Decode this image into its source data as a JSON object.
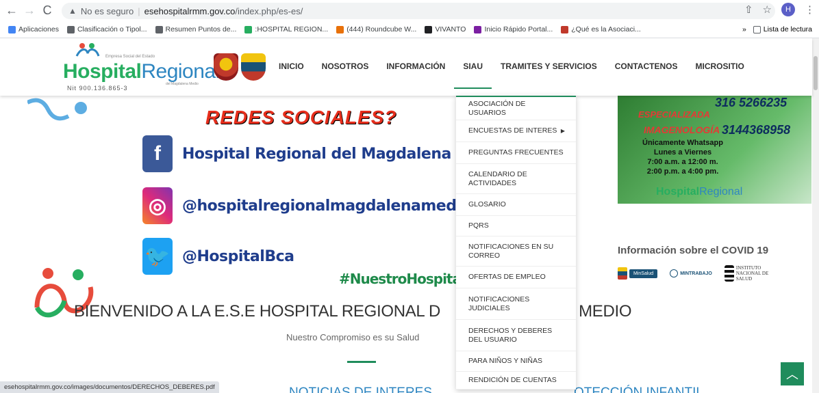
{
  "browser": {
    "security_label": "No es seguro",
    "url_host": "esehospitalrmm.gov.co",
    "url_path": "/index.php/es-es/",
    "profile_initial": "H",
    "bookmarks": [
      {
        "label": "Aplicaciones",
        "icon": "apps-icon",
        "color": "#4285f4"
      },
      {
        "label": "Clasificación o Tipol...",
        "icon": "house-icon",
        "color": "#5f6368"
      },
      {
        "label": "Resumen Puntos de...",
        "icon": "document-icon",
        "color": "#5f6368"
      },
      {
        "label": ":HOSPITAL REGION...",
        "icon": "hospital-logo-icon",
        "color": "#27ae60"
      },
      {
        "label": "(444) Roundcube W...",
        "icon": "roundcube-icon",
        "color": "#e8710a"
      },
      {
        "label": "VIVANTO",
        "icon": "vivanto-icon",
        "color": "#202124"
      },
      {
        "label": "Inicio Rápido Portal...",
        "icon": "portal-icon",
        "color": "#7b1fa2"
      },
      {
        "label": "¿Qué es la Asociaci...",
        "icon": "asociacion-icon",
        "color": "#c0392b"
      }
    ],
    "more_label": "»",
    "reading_list": "Lista de lectura",
    "status_url": "esehospitalrmm.gov.co/images/documentos/DERECHOS_DEBERES.pdf"
  },
  "logo": {
    "small": "Empresa Social del Estado",
    "word1": "Hospital",
    "word2": "Regional",
    "sub": "del Magdalena Medio",
    "nit": "Nit 900.136.865-3"
  },
  "nav": {
    "items": [
      "INICIO",
      "NOSOTROS",
      "INFORMACIÓN",
      "SIAU",
      "TRAMITES Y SERVICIOS",
      "CONTACTENOS",
      "MICROSITIO"
    ]
  },
  "dropdown": {
    "items": [
      {
        "label": "ASOCIACIÓN DE USUARIOS",
        "submenu": false
      },
      {
        "label": "ENCUESTAS DE INTERES",
        "submenu": true
      },
      {
        "label": "PREGUNTAS FRECUENTES",
        "submenu": false
      },
      {
        "label": "CALENDARIO DE ACTIVIDADES",
        "submenu": false
      },
      {
        "label": "GLOSARIO",
        "submenu": false
      },
      {
        "label": "PQRS",
        "submenu": false
      },
      {
        "label": "NOTIFICACIONES EN SU CORREO",
        "submenu": false
      },
      {
        "label": "OFERTAS DE EMPLEO",
        "submenu": false
      },
      {
        "label": "NOTIFICACIONES JUDICIALES",
        "submenu": false
      },
      {
        "label": "DERECHOS Y DEBERES DEL USUARIO",
        "submenu": false
      },
      {
        "label": "PARA NIÑOS Y NIÑAS",
        "submenu": false
      },
      {
        "label": "RENDICIÓN DE CUENTAS",
        "submenu": false
      }
    ]
  },
  "banner": {
    "headline_top": "REDES SOCIALES?",
    "facebook": "Hospital Regional del Magdalena Medio",
    "instagram": "@hospitalregionalmagdalenamedio",
    "twitter": "@HospitalBca",
    "hashtag": "#NuestroHospitalNue"
  },
  "promo": {
    "phone1": "316 5266235",
    "esp": "ESPECIALIZADA",
    "img": "IMAGENOLOGÍA",
    "phone2": "3144368958",
    "wa_line1": "Únicamente Whatsapp",
    "wa_line2": "Lunes a Viernes",
    "wa_line3": "7:00 a.m. a 12:00 m.",
    "wa_line4": "2:00 p.m. a 4:00 pm.",
    "brand1": "Hospital",
    "brand2": "Regional"
  },
  "covid": {
    "title": "Información sobre el COVID 19",
    "logos": [
      "MinSalud",
      "MINTRABAJO",
      "INSTITUTO NACIONAL DE SALUD"
    ]
  },
  "welcome": {
    "title": "BIENVENIDO A LA E.S.E HOSPITAL REGIONAL D",
    "title_end": "IA MEDIO",
    "tagline": "Nuestro Compromiso es su Salud",
    "news": "NOTICIAS DE INTERES",
    "news2": "OTECCIÓN INFANTIL"
  },
  "colors": {
    "accent": "#1f8c5c",
    "brand_green": "#27ae60",
    "brand_blue": "#2e86c1"
  }
}
